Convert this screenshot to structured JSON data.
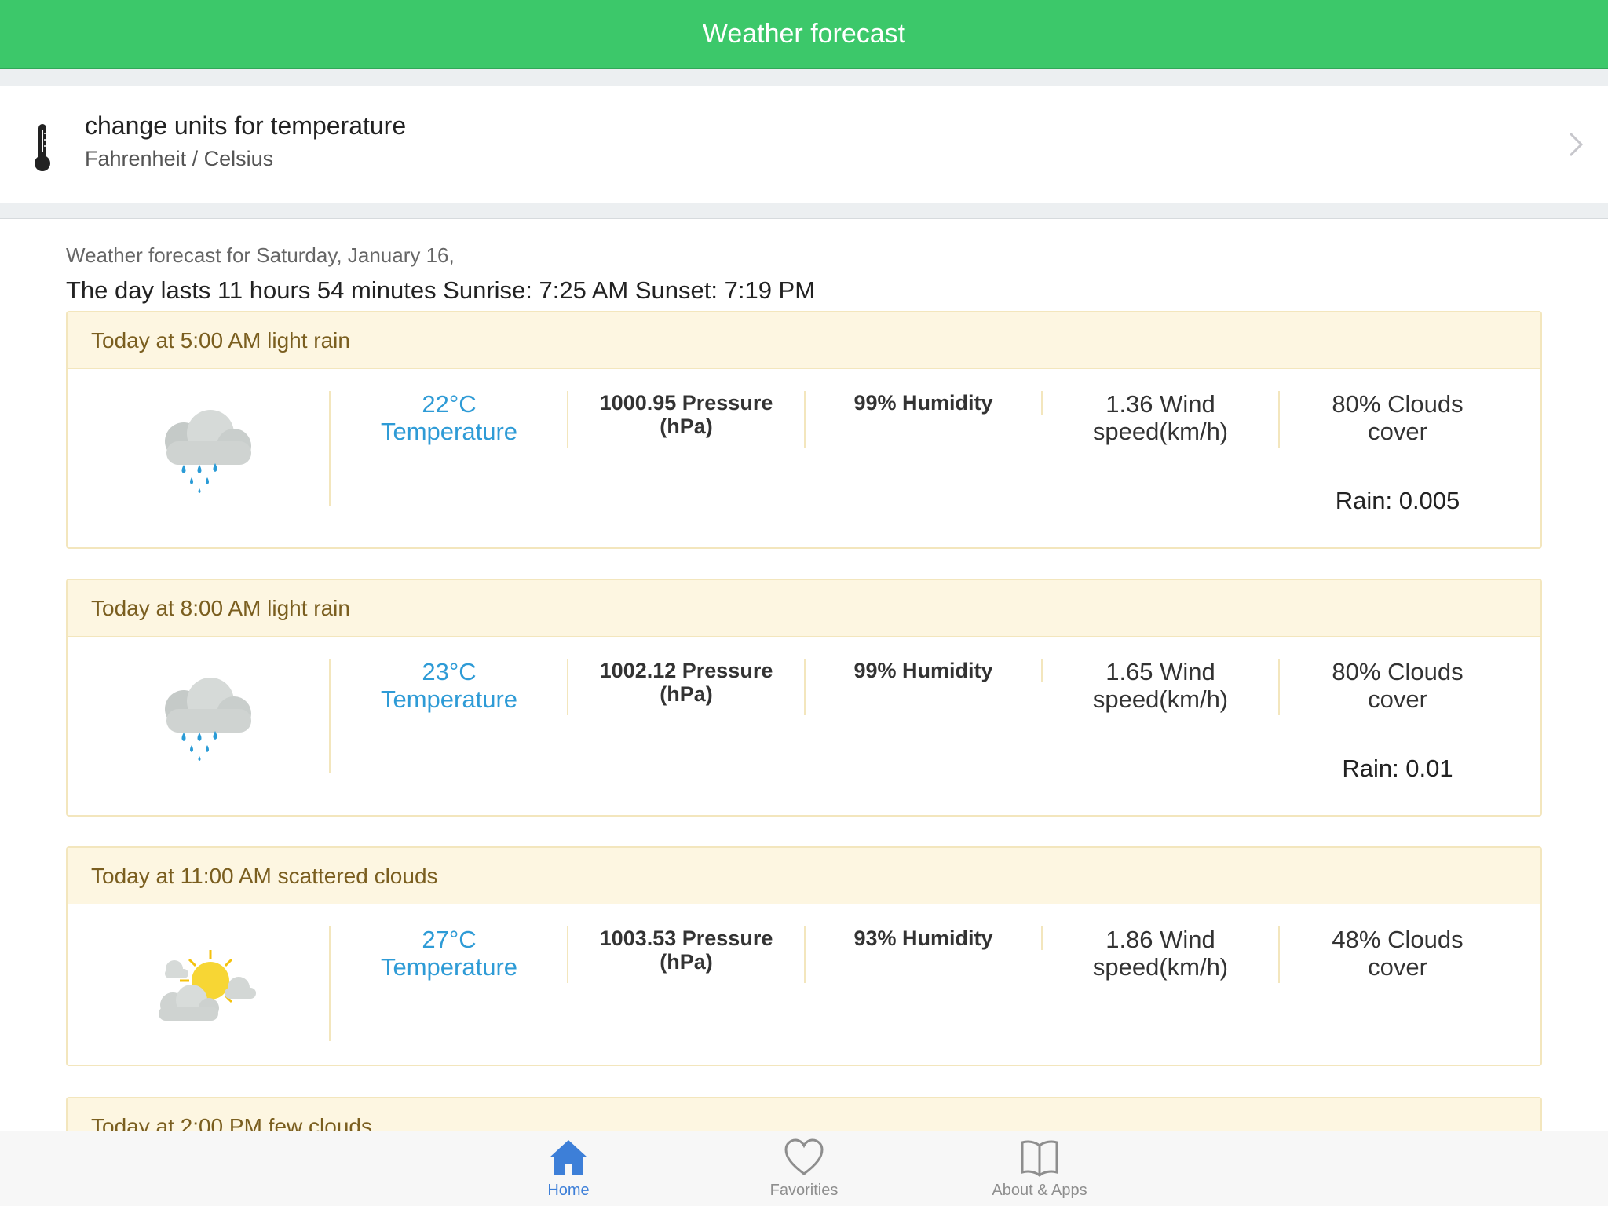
{
  "header": {
    "title": "Weather forecast"
  },
  "units": {
    "title": "change units for temperature",
    "subtitle": "Fahrenheit / Celsius"
  },
  "forecast": {
    "date_line": "Weather forecast for Saturday, January 16,",
    "day_info": "The day lasts 11 hours 54 minutes Sunrise: 7:25 AM Sunset: 7:19 PM",
    "cards": [
      {
        "title": "Today at 5:00 AM light rain",
        "icon": "rain-cloud-icon",
        "temp": "22°C",
        "temp_label": "Temperature",
        "pressure": "1000.95 Pressure",
        "pressure_unit": "(hPa)",
        "humidity": "99% Humidity",
        "wind": "1.36 Wind",
        "wind_unit": "speed(km/h)",
        "clouds": "80% Clouds",
        "clouds_label": "cover",
        "rain": "Rain: 0.005"
      },
      {
        "title": "Today at 8:00 AM light rain",
        "icon": "rain-cloud-icon",
        "temp": "23°C",
        "temp_label": "Temperature",
        "pressure": "1002.12 Pressure",
        "pressure_unit": "(hPa)",
        "humidity": "99% Humidity",
        "wind": "1.65 Wind",
        "wind_unit": "speed(km/h)",
        "clouds": "80% Clouds",
        "clouds_label": "cover",
        "rain": "Rain: 0.01"
      },
      {
        "title": "Today at 11:00 AM scattered clouds",
        "icon": "sun-cloud-icon",
        "temp": "27°C",
        "temp_label": "Temperature",
        "pressure": "1003.53 Pressure",
        "pressure_unit": "(hPa)",
        "humidity": "93% Humidity",
        "wind": "1.86 Wind",
        "wind_unit": "speed(km/h)",
        "clouds": "48% Clouds",
        "clouds_label": "cover"
      },
      {
        "title": "Today at 2:00 PM few clouds"
      }
    ]
  },
  "tabs": [
    {
      "label": "Home",
      "icon": "home-icon",
      "active": true
    },
    {
      "label": "Favorities",
      "icon": "heart-icon",
      "active": false
    },
    {
      "label": "About & Apps",
      "icon": "book-icon",
      "active": false
    }
  ],
  "colors": {
    "accent_green": "#3cc86a",
    "temperature_blue": "#2e9bd6",
    "card_header_bg": "#fdf6e1",
    "card_header_text": "#7a5e1f",
    "tab_active": "#3d7fd8"
  }
}
